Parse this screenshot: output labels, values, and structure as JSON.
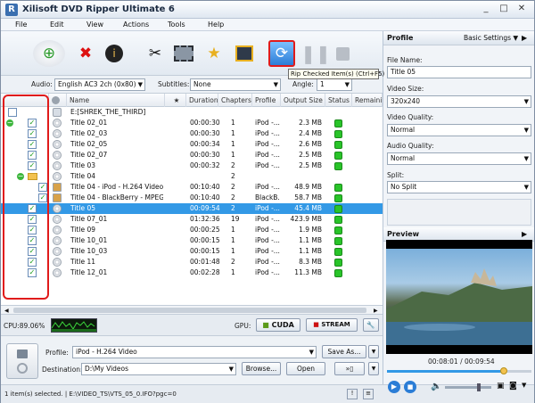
{
  "window": {
    "title": "Xilisoft DVD Ripper Ultimate 6",
    "min": "_",
    "max": "□",
    "close": "✕"
  },
  "menu": [
    "File",
    "Edit",
    "View",
    "Actions",
    "Tools",
    "Help"
  ],
  "tooltip": "Rip Checked Item(s) (Ctrl+F5)",
  "options": {
    "audio_label": "Audio:",
    "audio_value": "English AC3 2ch (0x80)",
    "subtitles_label": "Subtitles:",
    "subtitles_value": "None",
    "angle_label": "Angle:",
    "angle_value": "1"
  },
  "columns": [
    "Name",
    "★",
    "Duration",
    "Chapters",
    "Profile",
    "Output Size",
    "Status",
    "Remaining"
  ],
  "root": "E:[SHREK_THE_THIRD]",
  "rows": [
    {
      "name": "Title 02_01",
      "duration": "00:00:30",
      "chapters": "1",
      "profile": "iPod -...",
      "size": "2.3 MB"
    },
    {
      "name": "Title 02_03",
      "duration": "00:00:30",
      "chapters": "1",
      "profile": "iPod -...",
      "size": "2.4 MB"
    },
    {
      "name": "Title 02_05",
      "duration": "00:00:34",
      "chapters": "1",
      "profile": "iPod -...",
      "size": "2.6 MB"
    },
    {
      "name": "Title 02_07",
      "duration": "00:00:30",
      "chapters": "1",
      "profile": "iPod -...",
      "size": "2.5 MB"
    },
    {
      "name": "Title 03",
      "duration": "00:00:32",
      "chapters": "2",
      "profile": "iPod -...",
      "size": "2.5 MB"
    },
    {
      "name": "Title 04",
      "duration": "",
      "chapters": "2",
      "profile": "",
      "size": ""
    },
    {
      "name": "Title 04 - iPod - H.264 Video",
      "duration": "00:10:40",
      "chapters": "2",
      "profile": "iPod -...",
      "size": "48.9 MB"
    },
    {
      "name": "Title 04 - BlackBerry - MPEG4 ...",
      "duration": "00:10:40",
      "chapters": "2",
      "profile": "BlackB...",
      "size": "58.7 MB"
    },
    {
      "name": "Title 05",
      "duration": "00:09:54",
      "chapters": "2",
      "profile": "iPod -...",
      "size": "45.4 MB"
    },
    {
      "name": "Title 07_01",
      "duration": "01:32:36",
      "chapters": "19",
      "profile": "iPod -...",
      "size": "423.9 MB"
    },
    {
      "name": "Title 09",
      "duration": "00:00:25",
      "chapters": "1",
      "profile": "iPod -...",
      "size": "1.9 MB"
    },
    {
      "name": "Title 10_01",
      "duration": "00:00:15",
      "chapters": "1",
      "profile": "iPod -...",
      "size": "1.1 MB"
    },
    {
      "name": "Title 10_03",
      "duration": "00:00:15",
      "chapters": "1",
      "profile": "iPod -...",
      "size": "1.1 MB"
    },
    {
      "name": "Title 11",
      "duration": "00:01:48",
      "chapters": "2",
      "profile": "iPod -...",
      "size": "8.3 MB"
    },
    {
      "name": "Title 12_01",
      "duration": "00:02:28",
      "chapters": "1",
      "profile": "iPod -...",
      "size": "11.3 MB"
    }
  ],
  "cpu": {
    "label": "CPU:89.06%",
    "gpu_label": "GPU:",
    "cuda": "CUDA",
    "stream": "STREAM"
  },
  "profile": {
    "label": "Profile:",
    "value": "iPod - H.264 Video",
    "save_as": "Save As...",
    "dest_label": "Destination:",
    "dest_value": "D:\\My Videos",
    "browse": "Browse...",
    "open": "Open"
  },
  "status": "1 item(s) selected. | E:\\VIDEO_TS\\VTS_05_0.IFO?pgc=0",
  "right": {
    "profile_title": "Profile",
    "basic_settings": "Basic Settings",
    "file_name_label": "File Name:",
    "file_name": "Title 05",
    "video_size_label": "Video Size:",
    "video_size": "320x240",
    "video_quality_label": "Video Quality:",
    "video_quality": "Normal",
    "audio_quality_label": "Audio Quality:",
    "audio_quality": "Normal",
    "split_label": "Split:",
    "split": "No Split",
    "preview_title": "Preview",
    "time": "00:08:01 / 00:09:54"
  },
  "colors": {
    "selection": "#3399e6",
    "status_ok": "#29c429",
    "highlight": "#e01b1b"
  }
}
